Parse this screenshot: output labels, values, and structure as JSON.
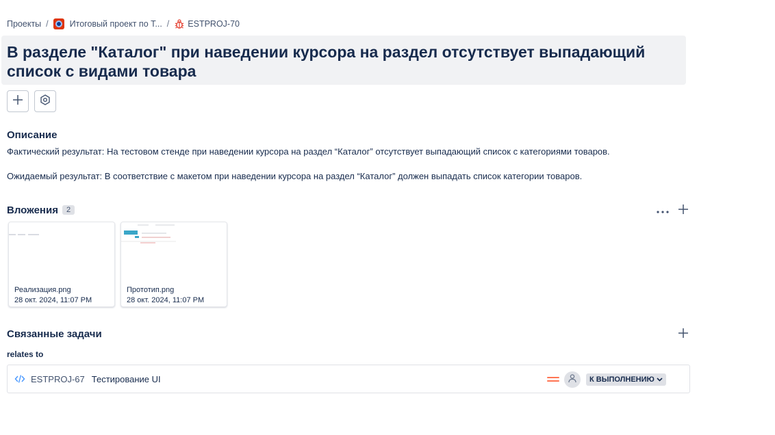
{
  "breadcrumb": {
    "projects": "Проекты",
    "project": "Итоговый проект по Т...",
    "issue_key": "ESTPROJ-70",
    "separator": "/"
  },
  "issue": {
    "title": "В разделе \"Каталог\" при наведении курсора на раздел отсутствует выпадающий список с видами товара"
  },
  "toolbar": {
    "add_icon": "plus-icon",
    "apps_icon": "hexagon-gear-icon"
  },
  "description": {
    "heading": "Описание",
    "line1": "Фактический результат: На тестовом стенде при наведении курсора на раздел “Каталог” отсутствует выпадающий список с категориями товаров.",
    "line2": "Ожидаемый результат: В соответствие с макетом при наведении курсора на раздел “Каталог” должен выпадать список категории товаров."
  },
  "attachments": {
    "heading": "Вложения",
    "count": "2",
    "items": [
      {
        "name": "Реализация.png",
        "date": "28 окт. 2024, 11:07 PM"
      },
      {
        "name": "Прототип.png",
        "date": "28 окт. 2024, 11:07 PM"
      }
    ]
  },
  "linked": {
    "heading": "Связанные задачи",
    "relation": "relates to",
    "items": [
      {
        "key": "ESTPROJ-67",
        "summary": "Тестирование UI",
        "status": "К ВЫПОЛНЕНИЮ",
        "priority": "medium"
      }
    ]
  },
  "colors": {
    "bug": "#e5493a",
    "priority_medium": "#ff7452",
    "story": "#4c9aff",
    "title_bg": "#f1f2f4"
  }
}
